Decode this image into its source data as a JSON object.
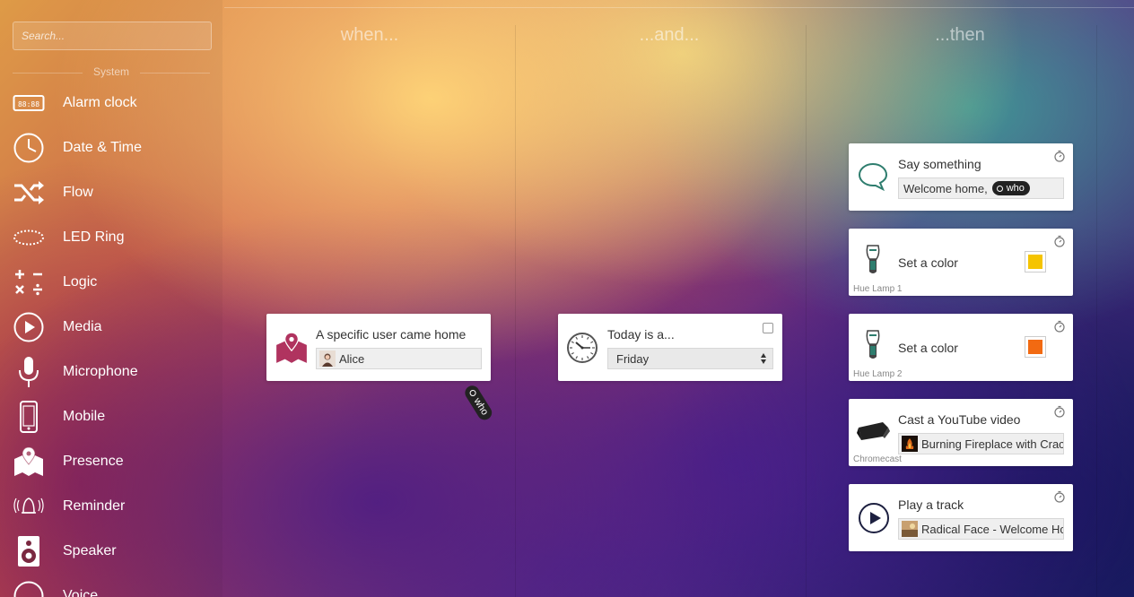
{
  "search": {
    "placeholder": "Search..."
  },
  "sidebar": {
    "section": "System",
    "items": [
      {
        "label": "Alarm clock",
        "icon": "alarm-clock-icon"
      },
      {
        "label": "Date & Time",
        "icon": "clock-icon"
      },
      {
        "label": "Flow",
        "icon": "shuffle-icon"
      },
      {
        "label": "LED Ring",
        "icon": "led-ring-icon"
      },
      {
        "label": "Logic",
        "icon": "logic-operators-icon"
      },
      {
        "label": "Media",
        "icon": "play-circle-icon"
      },
      {
        "label": "Microphone",
        "icon": "microphone-icon"
      },
      {
        "label": "Mobile",
        "icon": "mobile-phone-icon"
      },
      {
        "label": "Presence",
        "icon": "map-pin-icon"
      },
      {
        "label": "Reminder",
        "icon": "bell-ringing-icon"
      },
      {
        "label": "Speaker",
        "icon": "speaker-icon"
      },
      {
        "label": "Voice",
        "icon": "voice-icon"
      }
    ]
  },
  "columns": {
    "when": "when...",
    "and": "...and...",
    "then": "...then"
  },
  "when_card": {
    "title": "A specific user came home",
    "value": "Alice",
    "token": "who",
    "icon": "map-pin-icon",
    "icon_color": "#b0335f"
  },
  "and_card": {
    "title": "Today is a...",
    "selected": "Friday",
    "icon": "clock-icon"
  },
  "then_cards": [
    {
      "title": "Say something",
      "value": "Welcome home,",
      "token": "who",
      "icon": "speech-bubble-icon",
      "icon_color": "#2e7d6e"
    },
    {
      "title": "Set a color",
      "device": "Hue Lamp 1",
      "color": "#f5c400",
      "icon": "hue-lamp-icon"
    },
    {
      "title": "Set a color",
      "device": "Hue Lamp 2",
      "color": "#f26a12",
      "icon": "hue-lamp-icon"
    },
    {
      "title": "Cast a YouTube video",
      "device": "Chromecast",
      "value": "Burning Fireplace with Crac",
      "icon": "chromecast-icon"
    },
    {
      "title": "Play a track",
      "value": "Radical Face - Welcome Hc",
      "icon": "play-circle-icon"
    }
  ]
}
